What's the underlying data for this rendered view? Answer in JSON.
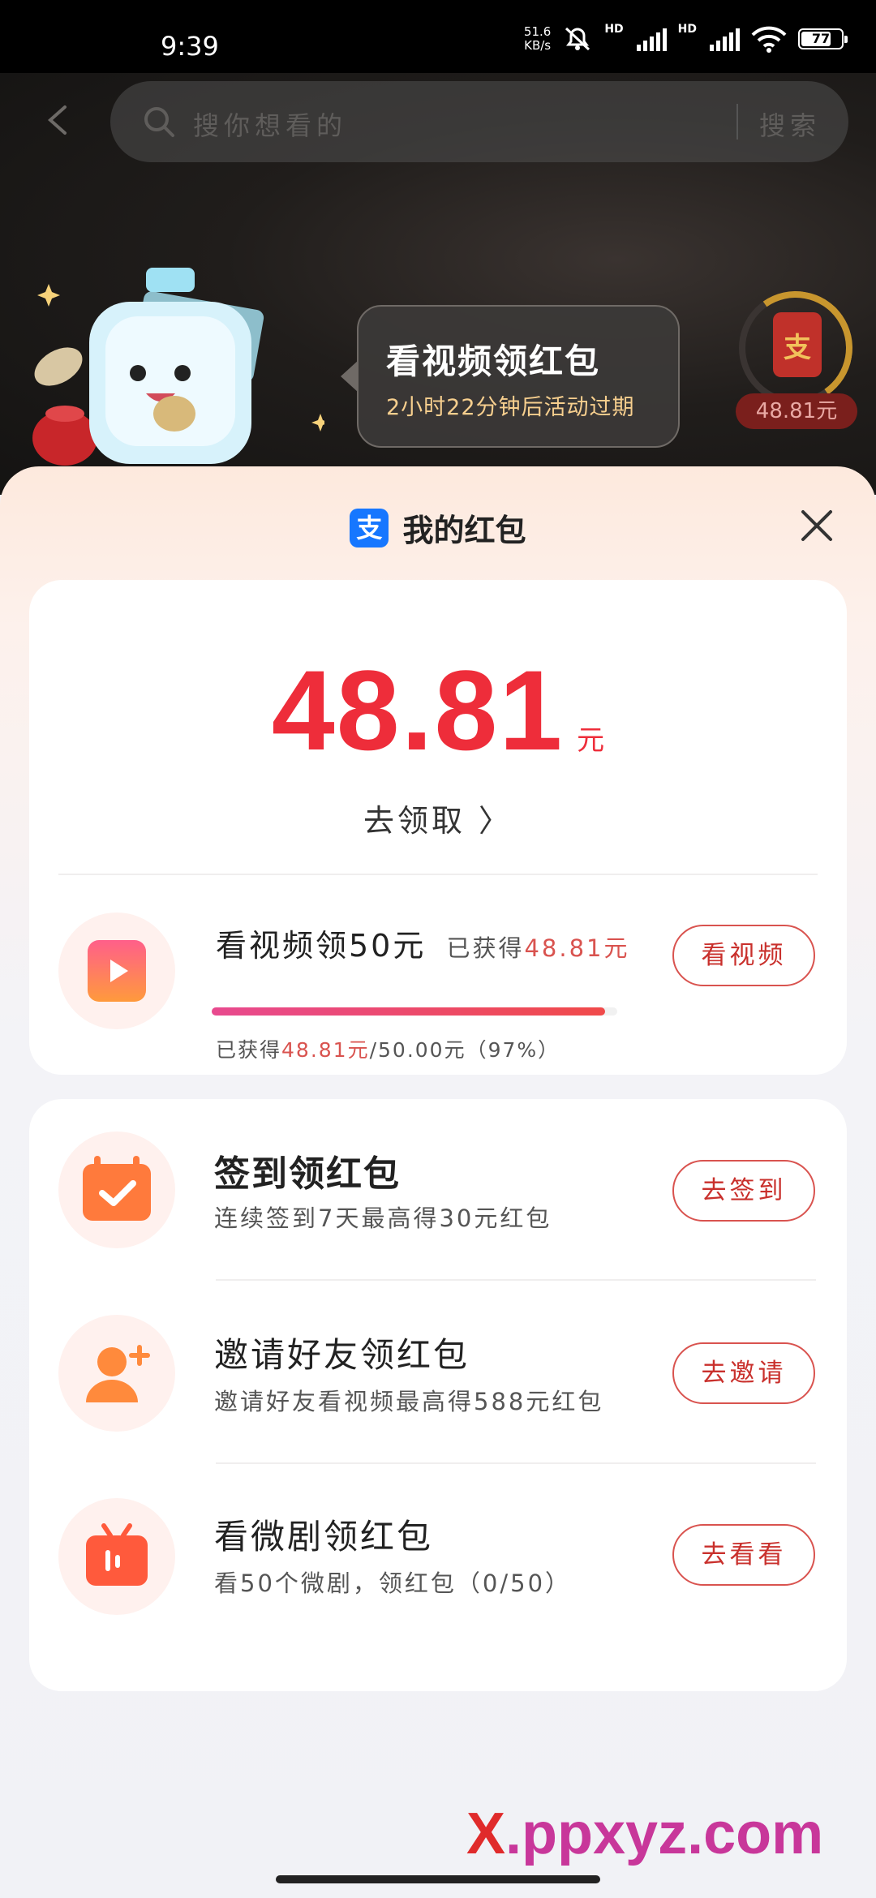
{
  "status_bar": {
    "time": "9:39",
    "net_speed_value": "51.6",
    "net_speed_unit": "KB/s",
    "hd_1": "HD",
    "hd_2": "HD",
    "battery": "77"
  },
  "search": {
    "placeholder": "搜你想看的",
    "button": "搜索"
  },
  "promo": {
    "title": "看视频领红包",
    "subtitle": "2小时22分钟后活动过期"
  },
  "red_packet_badge": {
    "icon_char": "支",
    "amount": "48.81元"
  },
  "sheet": {
    "logo_char": "支",
    "title": "我的红包"
  },
  "balance": {
    "amount": "48.81",
    "unit": "元",
    "claim_label": "去领取 〉"
  },
  "video_task": {
    "title": "看视频领50元",
    "earned_prefix": "已获得",
    "earned_value": "48.81元",
    "progress_prefix": "已获得",
    "progress_value": "48.81元",
    "progress_suffix": "/50.00元（97%）",
    "progress_fraction": 0.97,
    "button": "看视频"
  },
  "tasks": [
    {
      "title": "签到领红包",
      "subtitle": "连续签到7天最高得30元红包",
      "button": "去签到"
    },
    {
      "title": "邀请好友领红包",
      "subtitle": "邀请好友看视频最高得588元红包",
      "button": "去邀请"
    },
    {
      "title": "看微剧领红包",
      "subtitle": "看50个微剧，领红包（0/50）",
      "button": "去看看"
    }
  ],
  "watermark": {
    "x": "X",
    "rest": ".ppxyz.com"
  },
  "colors": {
    "accent_red": "#ee2d3a",
    "button_border": "#d9534f",
    "alipay_blue": "#1677ff",
    "promo_gold": "#f7cf8e"
  }
}
